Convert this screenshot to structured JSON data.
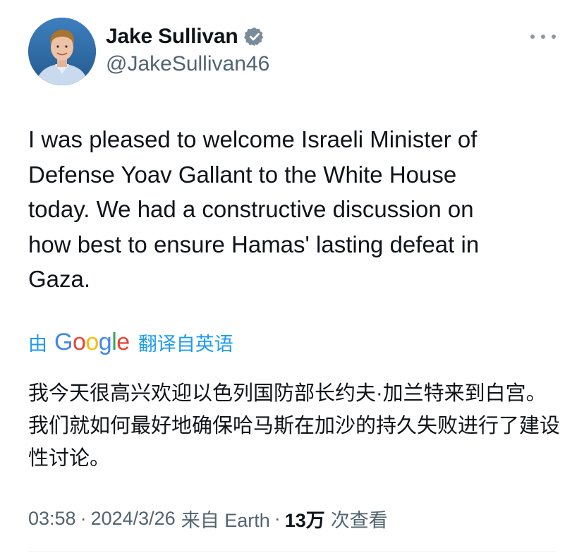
{
  "author": {
    "display_name": "Jake Sullivan",
    "handle": "@JakeSullivan46",
    "verified": true
  },
  "tweet": {
    "text": "I was pleased to welcome Israeli Minister of\nDefense Yoav Gallant to the White House\ntoday.  We had a constructive discussion on\nhow best to ensure Hamas' lasting defeat in\nGaza."
  },
  "translation": {
    "by_label": "由",
    "provider": "Google",
    "action_label": "翻译自英语",
    "text": "我今天很高兴欢迎以色列国防部长约夫·加兰特来到白宫。我们就如何最好地确保哈马斯在加沙的持久失败进行了建设性讨论。"
  },
  "meta": {
    "time": "03:58",
    "date": "2024/3/26",
    "source": "来自 Earth",
    "views_count": "13万",
    "views_label": "次查看"
  },
  "colors": {
    "text_primary": "#0f1419",
    "text_secondary": "#536471",
    "link_blue": "#1d9bf0",
    "verified_badge": "#7a8b99"
  }
}
